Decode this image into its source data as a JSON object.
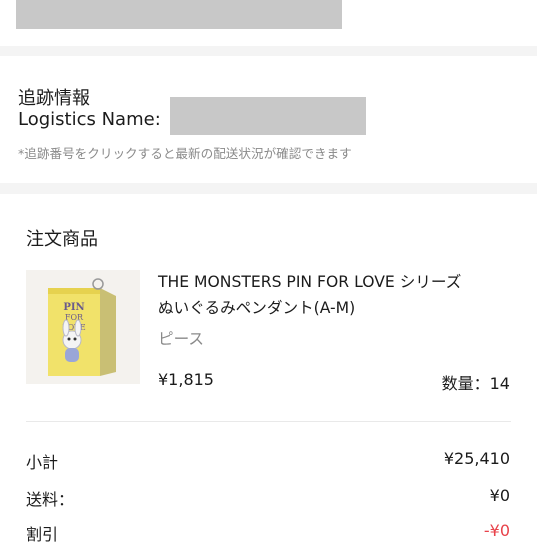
{
  "tracking": {
    "title": "追跡情報",
    "logistics_label": "Logistics Name:",
    "hint": "*追跡番号をクリックすると最新の配送状況が確認できます"
  },
  "order": {
    "section_title": "注文商品",
    "product": {
      "name_line1": "THE MONSTERS PIN FOR LOVE シリーズ",
      "name_line2": "ぬいぐるみペンダント(A-M)",
      "variant": "ピース",
      "price": "¥1,815",
      "quantity": "数量：14",
      "image_box_text": "PIN FOR LOVE"
    }
  },
  "summary": {
    "subtotal_label": "小計",
    "subtotal_value": "¥25,410",
    "shipping_label": "送料：",
    "shipping_value": "¥0",
    "discount_label": "割引",
    "discount_value": "-¥0"
  },
  "colors": {
    "discount": "#e8424a",
    "redaction": "#c8c8c8"
  }
}
